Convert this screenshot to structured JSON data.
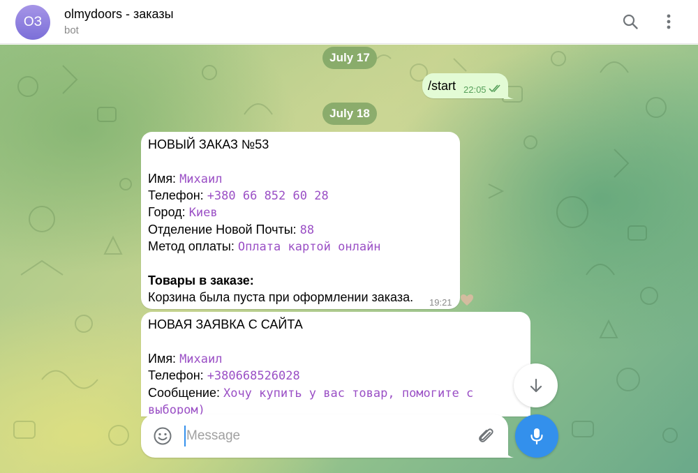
{
  "header": {
    "avatar_initials": "OЗ",
    "title": "olmydoors - заказы",
    "subtitle": "bot",
    "search_icon": "search-icon",
    "menu_icon": "more-vertical-icon"
  },
  "dates": {
    "first": "July 17",
    "second": "July 18"
  },
  "outgoing": {
    "text": "/start",
    "time": "22:05",
    "status": "read"
  },
  "order_message": {
    "title": "НОВЫЙ ЗАКАЗ №53",
    "name_label": "Имя: ",
    "name_value": "Михаил",
    "phone_label": "Телефон: ",
    "phone_value": "+380 66 852 60 28",
    "city_label": "Город: ",
    "city_value": "Киев",
    "branch_label": "Отделение Новой Почты: ",
    "branch_value": "88",
    "payment_label": "Метод оплаты: ",
    "payment_value": "Оплата картой онлайн",
    "goods_label": "Товары в заказе:",
    "goods_value": "Корзина была пуста при оформлении заказа.",
    "time": "19:21"
  },
  "request_message": {
    "title": "НОВАЯ ЗАЯВКА С САЙТА",
    "name_label": "Имя: ",
    "name_value": "Михаил",
    "phone_label": "Телефон: ",
    "phone_value": "+380668526028",
    "text_label": "Сообщение: ",
    "text_value_1": "Хочу купить у вас товар, помогите с",
    "text_value_2": "выбором)"
  },
  "composer": {
    "placeholder": "Message",
    "value": ""
  },
  "colors": {
    "accent": "#3390ec",
    "outgoing_bubble": "#e3fbd5",
    "mono_text": "#9a4fc5",
    "date_pill": "#6a9658"
  }
}
